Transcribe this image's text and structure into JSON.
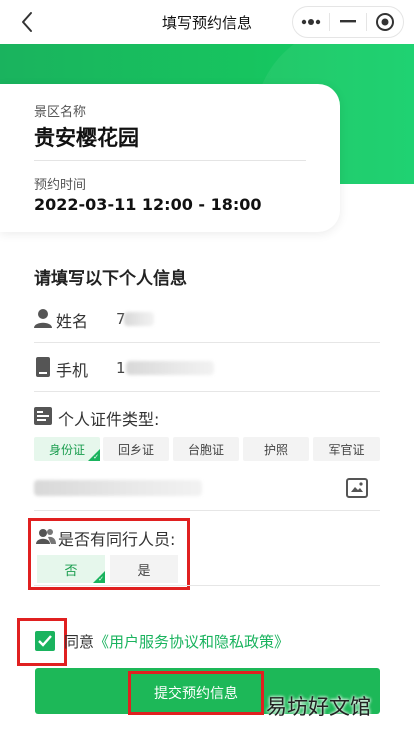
{
  "nav": {
    "title": "填写预约信息",
    "back_icon": "chevron-left-icon",
    "capsule_icons": [
      "more-dots-icon",
      "minimize-icon",
      "close-target-icon"
    ]
  },
  "colors": {
    "brand_green": "#1ab35e",
    "highlight_red": "#e02020",
    "link_green": "#1ab35e"
  },
  "card": {
    "scenic_label": "景区名称",
    "scenic_name": "贵安樱花园",
    "time_label": "预约时间",
    "time_value": "2022-03-11  12:00 - 18:00"
  },
  "form": {
    "section_title": "请填写以下个人信息",
    "name_label": "姓名",
    "name_value_partial": "7",
    "phone_label": "手机",
    "phone_value_partial": "1",
    "id_type_label": "个人证件类型:",
    "id_types": [
      {
        "label": "身份证",
        "selected": true
      },
      {
        "label": "回乡证",
        "selected": false
      },
      {
        "label": "台胞证",
        "selected": false
      },
      {
        "label": "护照",
        "selected": false
      },
      {
        "label": "军官证",
        "selected": false
      }
    ],
    "companion_label": "是否有同行人员:",
    "companion_options": [
      {
        "label": "否",
        "selected": true
      },
      {
        "label": "是",
        "selected": false
      }
    ]
  },
  "agree": {
    "checked": true,
    "prefix": "同意",
    "link_text": "《用户服务协议和隐私政策》"
  },
  "submit": {
    "label": "提交预约信息"
  },
  "watermark": "易坊好文馆"
}
